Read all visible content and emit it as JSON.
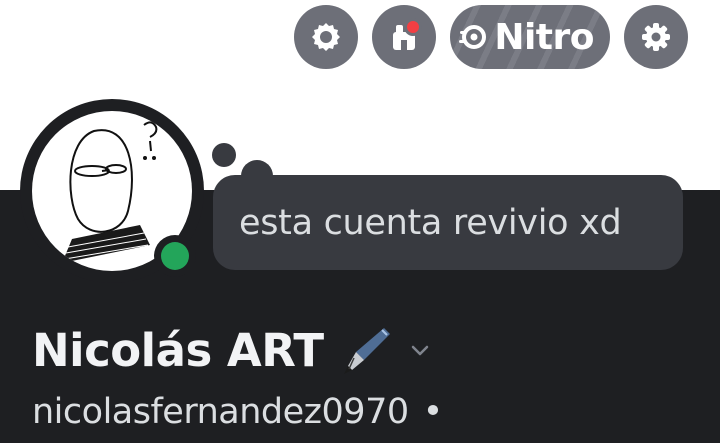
{
  "header": {
    "nitro_label": "Nitro",
    "icons": [
      "quests-icon",
      "shop-icon",
      "nitro-icon",
      "settings-icon"
    ],
    "notification_color": "#f23f43"
  },
  "profile": {
    "custom_status": "esta cuenta revivio xd",
    "display_name": "Nicolás ART",
    "display_name_emoji": "fountain-pen-icon",
    "username": "nicolasfernandez0970",
    "separator": "•",
    "status": "online",
    "status_color": "#23a55a"
  }
}
